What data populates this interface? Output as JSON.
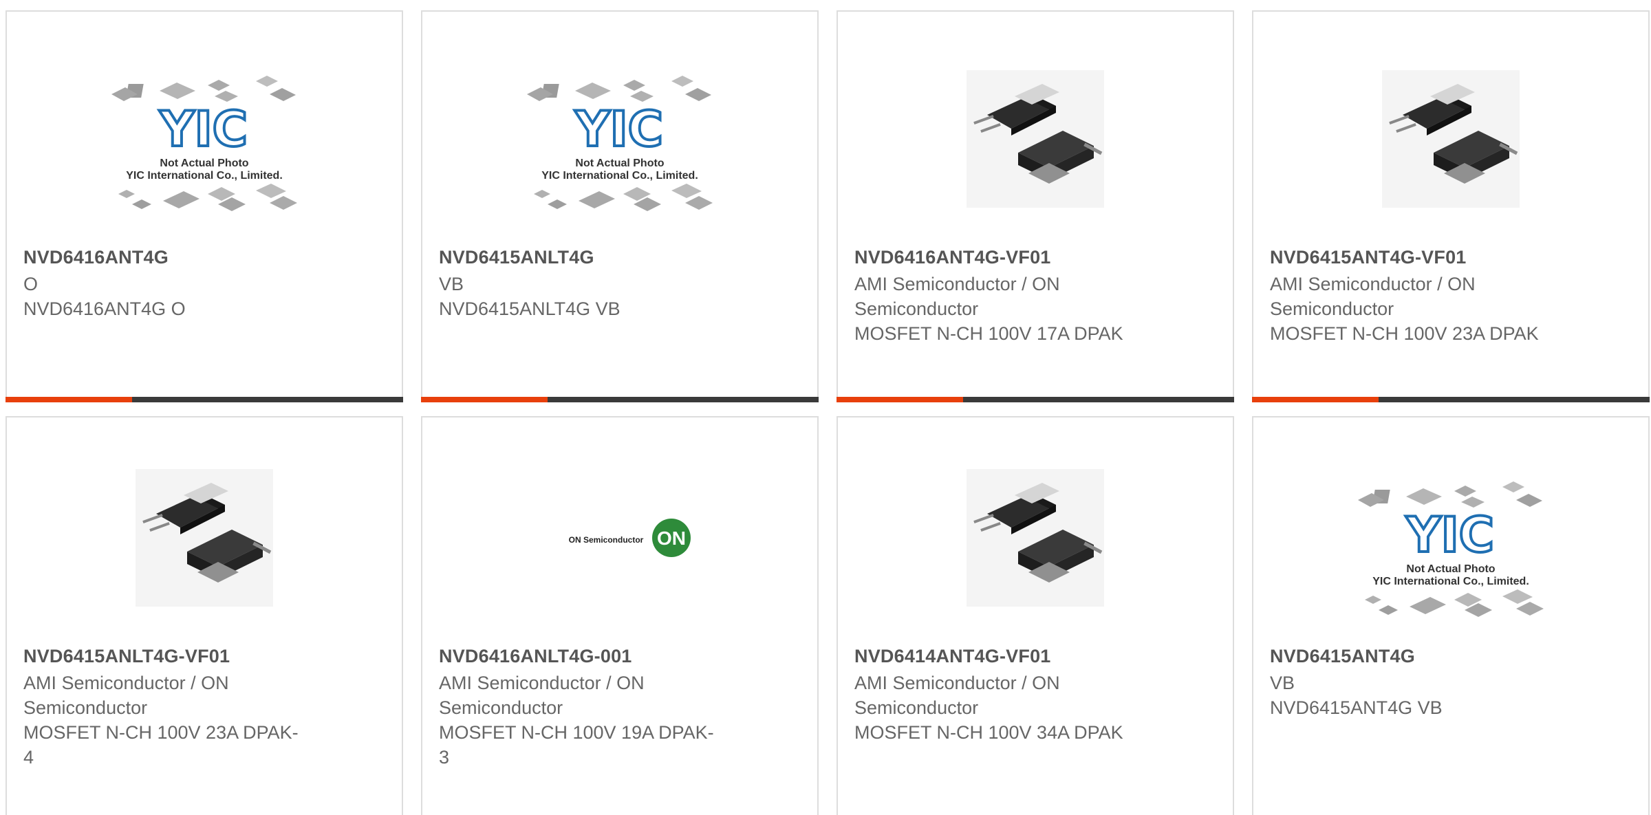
{
  "colors": {
    "accent": "#e8400c",
    "bar": "#3a3a3a",
    "title": "#555555",
    "text": "#666666"
  },
  "cards": [
    {
      "part": "NVD6416ANT4G",
      "manufacturer": "O",
      "line2": "",
      "description": "NVD6416ANT4G O",
      "description2": "",
      "image": "yic-placeholder-image",
      "image_caption1": "Not Actual Photo",
      "image_caption2": "YIC International Co., Limited."
    },
    {
      "part": "NVD6415ANLT4G",
      "manufacturer": "VB",
      "line2": "",
      "description": "NVD6415ANLT4G VB",
      "description2": "",
      "image": "yic-placeholder-image",
      "image_caption1": "Not Actual Photo",
      "image_caption2": "YIC International Co., Limited."
    },
    {
      "part": "NVD6416ANT4G-VF01",
      "manufacturer": "AMI Semiconductor / ON",
      "line2": "Semiconductor",
      "description": "MOSFET N-CH 100V 17A DPAK",
      "description2": "",
      "image": "dpak-package-image"
    },
    {
      "part": "NVD6415ANT4G-VF01",
      "manufacturer": "AMI Semiconductor / ON",
      "line2": "Semiconductor",
      "description": "MOSFET N-CH 100V 23A DPAK",
      "description2": "",
      "image": "dpak-package-image"
    },
    {
      "part": "NVD6415ANLT4G-VF01",
      "manufacturer": "AMI Semiconductor / ON",
      "line2": "Semiconductor",
      "description": "MOSFET N-CH 100V 23A DPAK-",
      "description2": "4",
      "image": "dpak-package-image"
    },
    {
      "part": "NVD6416ANLT4G-001",
      "manufacturer": "AMI Semiconductor / ON",
      "line2": "Semiconductor",
      "description": "MOSFET N-CH 100V 19A DPAK-",
      "description2": "3",
      "image": "on-semiconductor-logo",
      "logo_text": "ON Semiconductor",
      "logo_badge": "ON"
    },
    {
      "part": "NVD6414ANT4G-VF01",
      "manufacturer": "AMI Semiconductor / ON",
      "line2": "Semiconductor",
      "description": "MOSFET N-CH 100V 34A DPAK",
      "description2": "",
      "image": "dpak-package-image"
    },
    {
      "part": "NVD6415ANT4G",
      "manufacturer": "VB",
      "line2": "",
      "description": "NVD6415ANT4G VB",
      "description2": "",
      "image": "yic-placeholder-image",
      "image_caption1": "Not Actual Photo",
      "image_caption2": "YIC International Co., Limited."
    }
  ]
}
